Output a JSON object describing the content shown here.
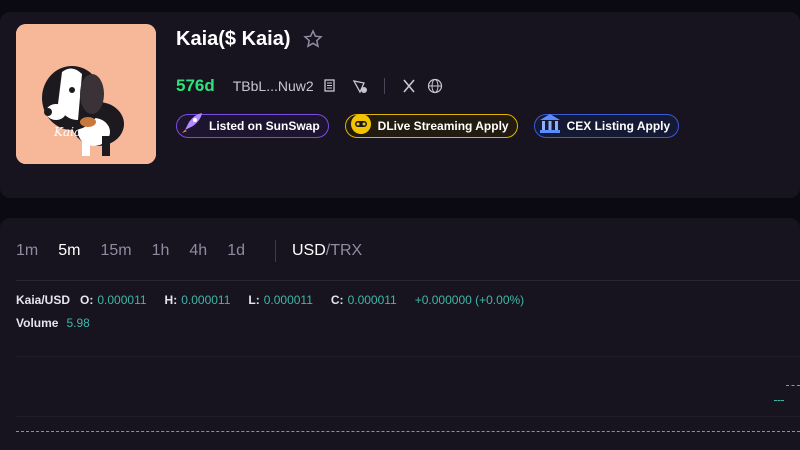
{
  "token": {
    "name": "Kaia($ Kaia)",
    "age": "576d",
    "address": "TBbL...Nuw2",
    "avatar_text": "Kaia"
  },
  "badges": [
    {
      "label": "Listed on SunSwap",
      "icon": "rocket-icon",
      "color": "#7a4de0"
    },
    {
      "label": "DLive Streaming Apply",
      "icon": "dlive-icon",
      "color": "#e0b400"
    },
    {
      "label": "CEX Listing Apply",
      "icon": "bank-icon",
      "color": "#3a5ad8"
    }
  ],
  "chart": {
    "intervals": [
      "1m",
      "5m",
      "15m",
      "1h",
      "4h",
      "1d"
    ],
    "active_interval": "5m",
    "currency_primary": "USD",
    "currency_slash": "/",
    "currency_secondary": "TRX",
    "symbol": "Kaia/USD",
    "ohlc": {
      "o_label": "O:",
      "o": "0.000011",
      "h_label": "H:",
      "h": "0.000011",
      "l_label": "L:",
      "l": "0.000011",
      "c_label": "C:",
      "c": "0.000011",
      "change": "+0.000000 (+0.00%)"
    },
    "volume_label": "Volume",
    "volume": "5.98"
  },
  "colors": {
    "age_green": "#2ee27a",
    "value_teal": "#3fb6a8",
    "background": "#0b0a12",
    "card": "#17141f"
  }
}
